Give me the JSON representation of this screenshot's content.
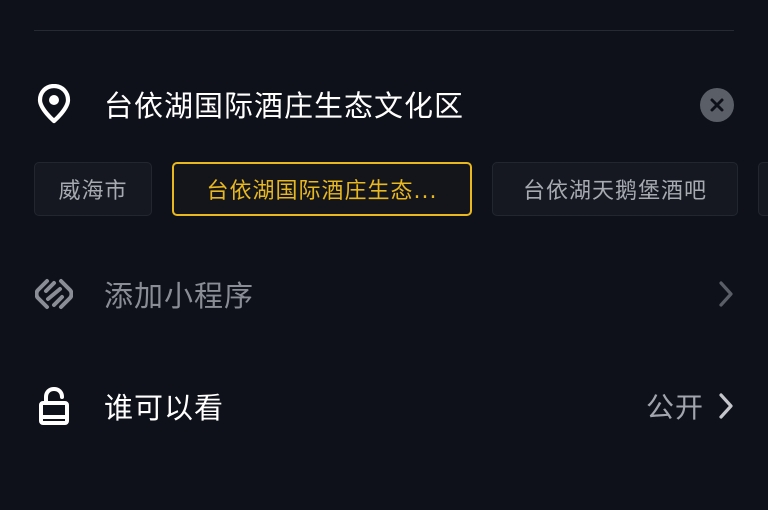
{
  "location": {
    "title": "台依湖国际酒庄生态文化区",
    "pin_icon": "location-pin-icon",
    "clear_icon": "clear-icon"
  },
  "location_suggestions": [
    {
      "label": "威海市",
      "selected": false
    },
    {
      "label": "台依湖国际酒庄生态...",
      "selected": true
    },
    {
      "label": "台依湖天鹅堡酒吧",
      "selected": false
    }
  ],
  "mini_program": {
    "label": "添加小程序",
    "icon": "mini-program-icon",
    "chevron_icon": "chevron-right-icon"
  },
  "visibility": {
    "label": "谁可以看",
    "value": "公开",
    "icon": "unlock-icon",
    "chevron_icon": "chevron-right-icon"
  },
  "colors": {
    "background": "#0f111a",
    "accent": "#e9b81e",
    "muted_text": "#8a8d95",
    "chip_text": "#a7aab1"
  }
}
